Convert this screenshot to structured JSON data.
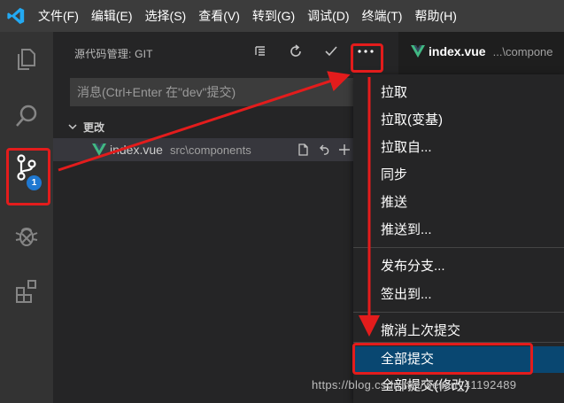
{
  "menubar": {
    "items": [
      "文件(F)",
      "编辑(E)",
      "选择(S)",
      "查看(V)",
      "转到(G)",
      "调试(D)",
      "终端(T)",
      "帮助(H)"
    ]
  },
  "activity_bar": {
    "icons": [
      "files-icon",
      "search-icon",
      "source-control-icon",
      "debug-icon",
      "extensions-icon"
    ],
    "badge": "1"
  },
  "source_control": {
    "title": "源代码管理: GIT",
    "message_placeholder": "消息(Ctrl+Enter 在\"dev\"提交)",
    "changes_label": "更改",
    "file_name": "index.vue",
    "file_path": "src\\components",
    "file_actions": [
      "open-file-icon",
      "discard-icon",
      "stage-icon"
    ]
  },
  "editor_tab": {
    "name": "index.vue",
    "path": "...\\compone"
  },
  "dropdown_menu": {
    "groups": [
      [
        "拉取",
        "拉取(变基)",
        "拉取自...",
        "同步",
        "推送",
        "推送到..."
      ],
      [
        "发布分支...",
        "签出到..."
      ],
      [
        "撤消上次提交"
      ],
      [
        "全部提交",
        "全部提交(修改)"
      ]
    ],
    "active_item": "全部提交"
  },
  "watermark": "https://blog.csdn.net/weixin_41192489",
  "colors": {
    "annotation_red": "#e31c1c",
    "vue_green": "#41b883",
    "badge_blue": "#1f78d1",
    "active_highlight": "#094771"
  }
}
